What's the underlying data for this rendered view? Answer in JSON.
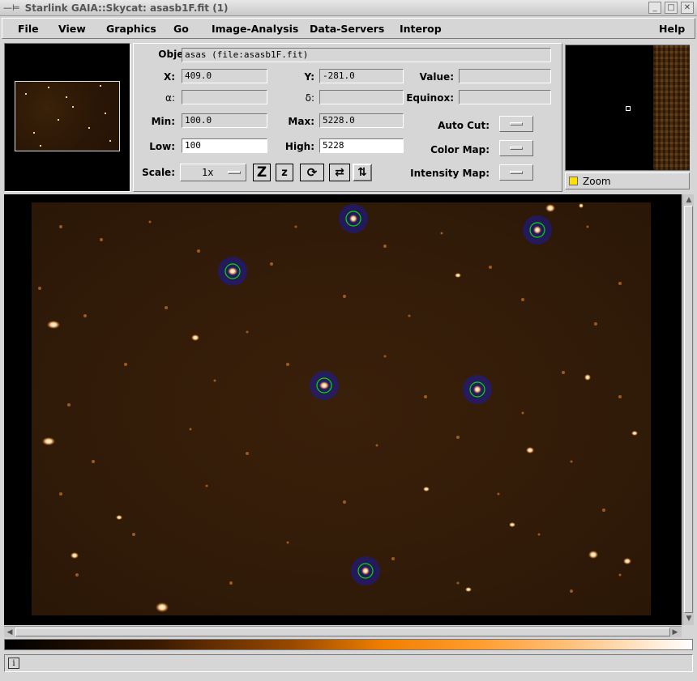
{
  "window": {
    "title": "Starlink GAIA::Skycat: asasb1F.fit (1)"
  },
  "menu": {
    "file": "File",
    "view": "View",
    "graphics": "Graphics",
    "go": "Go",
    "image_analysis": "Image-Analysis",
    "data_servers": "Data-Servers",
    "interop": "Interop",
    "help": "Help"
  },
  "info": {
    "object_label": "Object:",
    "object_value": "asas (file:asasb1F.fit)",
    "x_label": "X:",
    "x_value": "409.0",
    "y_label": "Y:",
    "y_value": "-281.0",
    "value_label": "Value:",
    "value_value": "",
    "alpha_label": "α:",
    "alpha_value": "",
    "delta_label": "δ:",
    "delta_value": "",
    "equinox_label": "Equinox:",
    "equinox_value": "",
    "min_label": "Min:",
    "min_value": "100.0",
    "max_label": "Max:",
    "max_value": "5228.0",
    "low_label": "Low:",
    "low_value": "100",
    "high_label": "High:",
    "high_value": "5228",
    "autocut_label": "Auto Cut:",
    "colormap_label": "Color Map:",
    "intensitymap_label": "Intensity Map:",
    "scale_label": "Scale:",
    "scale_value": "1x"
  },
  "tools": {
    "zoom_in": "Z",
    "zoom_out": "z"
  },
  "zoom": {
    "label": "Zoom",
    "checked": true
  },
  "status": {
    "info_glyph": "i"
  },
  "colors": {
    "image_bg": "#2a1606",
    "star_core": "#fff6e0",
    "aperture_ring": "#1a1aa0",
    "aperture_inner": "#00e000"
  }
}
